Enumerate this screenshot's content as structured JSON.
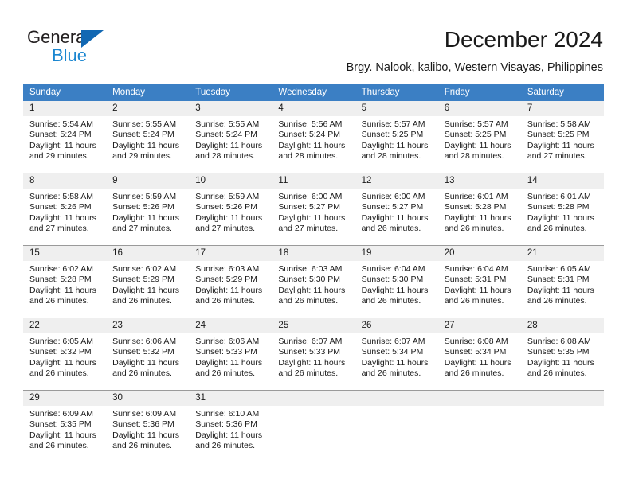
{
  "brand": {
    "name_part1": "General",
    "name_part2": "Blue",
    "triangle_icon": "triangle-icon",
    "accent_dark": "#231f20",
    "accent_blue": "#1a86d0",
    "triangle_blue": "#1268b3"
  },
  "header": {
    "title": "December 2024",
    "subtitle": "Brgy. Nalook, kalibo, Western Visayas, Philippines"
  },
  "calendar": {
    "header_bg": "#3b7fc4",
    "daynum_bg": "#efefef",
    "weekday_headers": [
      "Sunday",
      "Monday",
      "Tuesday",
      "Wednesday",
      "Thursday",
      "Friday",
      "Saturday"
    ],
    "weeks": [
      [
        {
          "day": "1",
          "sunrise": "Sunrise: 5:54 AM",
          "sunset": "Sunset: 5:24 PM",
          "daylight": "Daylight: 11 hours and 29 minutes."
        },
        {
          "day": "2",
          "sunrise": "Sunrise: 5:55 AM",
          "sunset": "Sunset: 5:24 PM",
          "daylight": "Daylight: 11 hours and 29 minutes."
        },
        {
          "day": "3",
          "sunrise": "Sunrise: 5:55 AM",
          "sunset": "Sunset: 5:24 PM",
          "daylight": "Daylight: 11 hours and 28 minutes."
        },
        {
          "day": "4",
          "sunrise": "Sunrise: 5:56 AM",
          "sunset": "Sunset: 5:24 PM",
          "daylight": "Daylight: 11 hours and 28 minutes."
        },
        {
          "day": "5",
          "sunrise": "Sunrise: 5:57 AM",
          "sunset": "Sunset: 5:25 PM",
          "daylight": "Daylight: 11 hours and 28 minutes."
        },
        {
          "day": "6",
          "sunrise": "Sunrise: 5:57 AM",
          "sunset": "Sunset: 5:25 PM",
          "daylight": "Daylight: 11 hours and 28 minutes."
        },
        {
          "day": "7",
          "sunrise": "Sunrise: 5:58 AM",
          "sunset": "Sunset: 5:25 PM",
          "daylight": "Daylight: 11 hours and 27 minutes."
        }
      ],
      [
        {
          "day": "8",
          "sunrise": "Sunrise: 5:58 AM",
          "sunset": "Sunset: 5:26 PM",
          "daylight": "Daylight: 11 hours and 27 minutes."
        },
        {
          "day": "9",
          "sunrise": "Sunrise: 5:59 AM",
          "sunset": "Sunset: 5:26 PM",
          "daylight": "Daylight: 11 hours and 27 minutes."
        },
        {
          "day": "10",
          "sunrise": "Sunrise: 5:59 AM",
          "sunset": "Sunset: 5:26 PM",
          "daylight": "Daylight: 11 hours and 27 minutes."
        },
        {
          "day": "11",
          "sunrise": "Sunrise: 6:00 AM",
          "sunset": "Sunset: 5:27 PM",
          "daylight": "Daylight: 11 hours and 27 minutes."
        },
        {
          "day": "12",
          "sunrise": "Sunrise: 6:00 AM",
          "sunset": "Sunset: 5:27 PM",
          "daylight": "Daylight: 11 hours and 26 minutes."
        },
        {
          "day": "13",
          "sunrise": "Sunrise: 6:01 AM",
          "sunset": "Sunset: 5:28 PM",
          "daylight": "Daylight: 11 hours and 26 minutes."
        },
        {
          "day": "14",
          "sunrise": "Sunrise: 6:01 AM",
          "sunset": "Sunset: 5:28 PM",
          "daylight": "Daylight: 11 hours and 26 minutes."
        }
      ],
      [
        {
          "day": "15",
          "sunrise": "Sunrise: 6:02 AM",
          "sunset": "Sunset: 5:28 PM",
          "daylight": "Daylight: 11 hours and 26 minutes."
        },
        {
          "day": "16",
          "sunrise": "Sunrise: 6:02 AM",
          "sunset": "Sunset: 5:29 PM",
          "daylight": "Daylight: 11 hours and 26 minutes."
        },
        {
          "day": "17",
          "sunrise": "Sunrise: 6:03 AM",
          "sunset": "Sunset: 5:29 PM",
          "daylight": "Daylight: 11 hours and 26 minutes."
        },
        {
          "day": "18",
          "sunrise": "Sunrise: 6:03 AM",
          "sunset": "Sunset: 5:30 PM",
          "daylight": "Daylight: 11 hours and 26 minutes."
        },
        {
          "day": "19",
          "sunrise": "Sunrise: 6:04 AM",
          "sunset": "Sunset: 5:30 PM",
          "daylight": "Daylight: 11 hours and 26 minutes."
        },
        {
          "day": "20",
          "sunrise": "Sunrise: 6:04 AM",
          "sunset": "Sunset: 5:31 PM",
          "daylight": "Daylight: 11 hours and 26 minutes."
        },
        {
          "day": "21",
          "sunrise": "Sunrise: 6:05 AM",
          "sunset": "Sunset: 5:31 PM",
          "daylight": "Daylight: 11 hours and 26 minutes."
        }
      ],
      [
        {
          "day": "22",
          "sunrise": "Sunrise: 6:05 AM",
          "sunset": "Sunset: 5:32 PM",
          "daylight": "Daylight: 11 hours and 26 minutes."
        },
        {
          "day": "23",
          "sunrise": "Sunrise: 6:06 AM",
          "sunset": "Sunset: 5:32 PM",
          "daylight": "Daylight: 11 hours and 26 minutes."
        },
        {
          "day": "24",
          "sunrise": "Sunrise: 6:06 AM",
          "sunset": "Sunset: 5:33 PM",
          "daylight": "Daylight: 11 hours and 26 minutes."
        },
        {
          "day": "25",
          "sunrise": "Sunrise: 6:07 AM",
          "sunset": "Sunset: 5:33 PM",
          "daylight": "Daylight: 11 hours and 26 minutes."
        },
        {
          "day": "26",
          "sunrise": "Sunrise: 6:07 AM",
          "sunset": "Sunset: 5:34 PM",
          "daylight": "Daylight: 11 hours and 26 minutes."
        },
        {
          "day": "27",
          "sunrise": "Sunrise: 6:08 AM",
          "sunset": "Sunset: 5:34 PM",
          "daylight": "Daylight: 11 hours and 26 minutes."
        },
        {
          "day": "28",
          "sunrise": "Sunrise: 6:08 AM",
          "sunset": "Sunset: 5:35 PM",
          "daylight": "Daylight: 11 hours and 26 minutes."
        }
      ],
      [
        {
          "day": "29",
          "sunrise": "Sunrise: 6:09 AM",
          "sunset": "Sunset: 5:35 PM",
          "daylight": "Daylight: 11 hours and 26 minutes."
        },
        {
          "day": "30",
          "sunrise": "Sunrise: 6:09 AM",
          "sunset": "Sunset: 5:36 PM",
          "daylight": "Daylight: 11 hours and 26 minutes."
        },
        {
          "day": "31",
          "sunrise": "Sunrise: 6:10 AM",
          "sunset": "Sunset: 5:36 PM",
          "daylight": "Daylight: 11 hours and 26 minutes."
        },
        {
          "day": "",
          "sunrise": "",
          "sunset": "",
          "daylight": ""
        },
        {
          "day": "",
          "sunrise": "",
          "sunset": "",
          "daylight": ""
        },
        {
          "day": "",
          "sunrise": "",
          "sunset": "",
          "daylight": ""
        },
        {
          "day": "",
          "sunrise": "",
          "sunset": "",
          "daylight": ""
        }
      ]
    ]
  }
}
